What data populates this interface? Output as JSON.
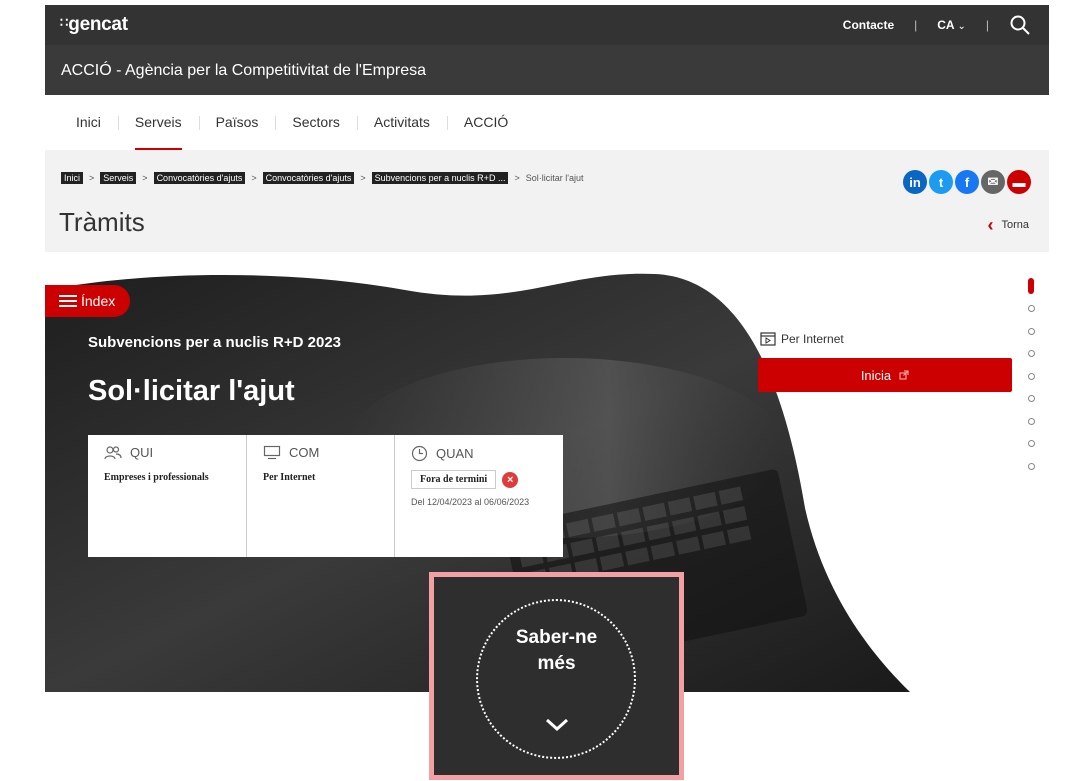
{
  "header": {
    "logo": "gencat",
    "logo_dots": "∷",
    "contact": "Contacte",
    "language": "CA",
    "org_name": "ACCIÓ - Agència per la Competitivitat de l'Empresa"
  },
  "nav": {
    "items": [
      {
        "label": "Inici"
      },
      {
        "label": "Serveis"
      },
      {
        "label": "Països"
      },
      {
        "label": "Sectors"
      },
      {
        "label": "Activitats"
      },
      {
        "label": "ACCIÓ"
      }
    ],
    "active": "Serveis"
  },
  "breadcrumb": {
    "items": [
      "Inici",
      "Serveis",
      "Convocatòries d'ajuts",
      "Convocatòries d'ajuts",
      "Subvencions per a nuclis R+D ..."
    ],
    "separator": ">",
    "current": "Sol·licitar l'ajut"
  },
  "page": {
    "title": "Tràmits",
    "back_label": "Torna"
  },
  "social": [
    {
      "icon": "linkedin-icon",
      "glyph": "in",
      "color": "#0a66c2"
    },
    {
      "icon": "twitter-icon",
      "glyph": "t",
      "color": "#1d9bf0"
    },
    {
      "icon": "facebook-icon",
      "glyph": "f",
      "color": "#1877f2"
    },
    {
      "icon": "email-icon",
      "glyph": "✉",
      "color": "#666666"
    },
    {
      "icon": "print-icon",
      "glyph": "▬",
      "color": "#cc0000"
    }
  ],
  "hero": {
    "index_label": "Índex",
    "subtitle": "Subvencions per a nuclis R+D 2023",
    "title": "Sol·licitar l'ajut"
  },
  "info": {
    "qui": {
      "heading": "QUI",
      "value": "Empreses i professionals"
    },
    "com": {
      "heading": "COM",
      "value": "Per Internet"
    },
    "quan": {
      "heading": "QUAN",
      "status": "Fora de termini",
      "dates": "Del 12/04/2023 al 06/06/2023"
    }
  },
  "side": {
    "channel": "Per Internet",
    "start_button": "Inicia"
  },
  "more": {
    "label_line1": "Saber-ne",
    "label_line2": "més"
  },
  "colors": {
    "accent": "#cc0000",
    "header_dark": "#333333",
    "highlight": "#f2a0a3"
  }
}
